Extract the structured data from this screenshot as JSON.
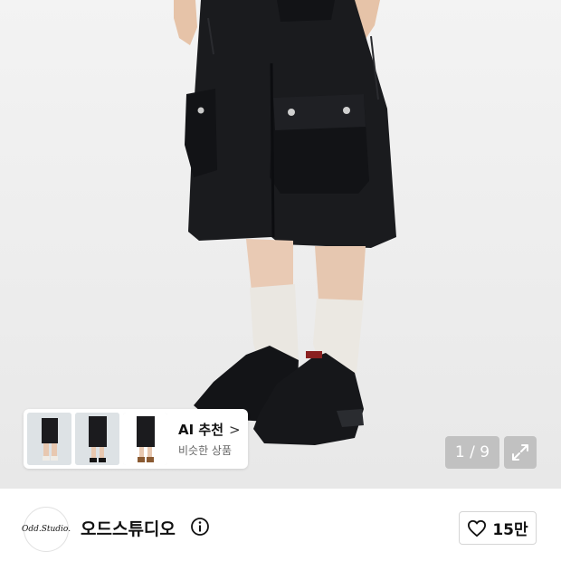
{
  "ai_recommend": {
    "title": "AI 추천",
    "subtitle": "비슷한 상품",
    "chevron": ">",
    "thumb_icons": [
      "thumbnail-1",
      "thumbnail-2",
      "thumbnail-3"
    ]
  },
  "gallery": {
    "counter": "1 / 9",
    "expand_icon": "expand-icon"
  },
  "brand": {
    "logo_text": "Odd.Studio.",
    "name": "오드스튜디오",
    "info_icon": "info-icon"
  },
  "like": {
    "count": "15만",
    "icon": "heart-outline-icon"
  }
}
